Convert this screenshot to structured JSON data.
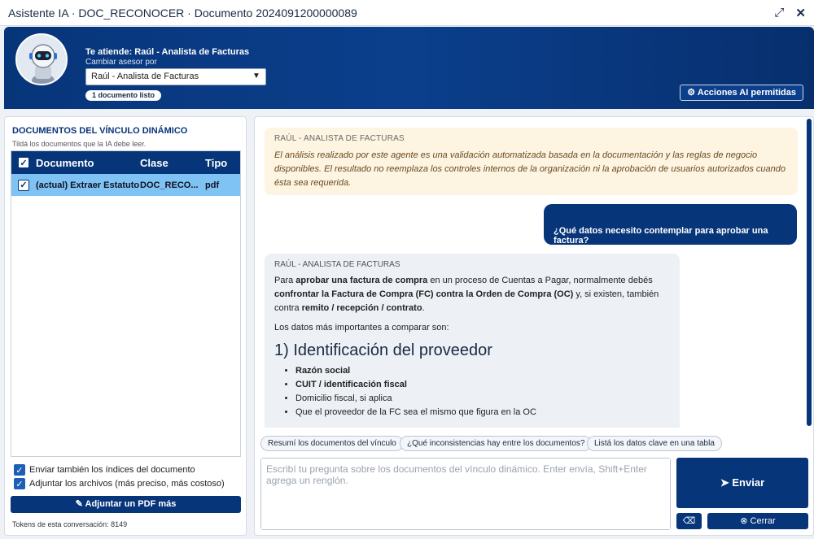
{
  "window": {
    "title": "Asistente IA · DOC_RECONOCER · Documento 2024091200000089"
  },
  "header": {
    "attending": "Te atiende: Raúl - Analista de Facturas",
    "change_label": "Cambiar asesor por",
    "advisor_selected": "Raúl - Analista de Facturas",
    "docs_badge": "1 documento listo",
    "actions_button": "Acciones AI permitidas"
  },
  "left": {
    "title": "DOCUMENTOS DEL VÍNCULO DINÁMICO",
    "subtitle": "Tildá los documentos que la IA debe leer.",
    "columns": {
      "doc": "Documento",
      "class": "Clase",
      "type": "Tipo"
    },
    "rows": [
      {
        "doc": "(actual) Extraer Estatuto",
        "class": "DOC_RECO...",
        "type": "pdf"
      }
    ],
    "option_indexes": "Enviar también los índices del documento",
    "option_files": "Adjuntar los archivos (más preciso, más costoso)",
    "attach_pdf": "Adjuntar un PDF más",
    "tokens": "Tokens de esta conversación: 8149"
  },
  "chat": {
    "notice_who": "RAÚL - ANALISTA DE FACTURAS",
    "notice_text": "El análisis realizado por este agente es una validación automatizada basada en la documentación y las reglas de negocio disponibles. El resultado no reemplaza los controles internos de la organización ni la aprobación de usuarios autorizados cuando ésta sea requerida.",
    "user_msg": "¿Qué datos necesito contemplar para aprobar una factura?",
    "ai_who": "RAÚL - ANALISTA DE FACTURAS",
    "ai_p1_a": "Para ",
    "ai_p1_b": "aprobar una factura de compra",
    "ai_p1_c": " en un proceso de Cuentas a Pagar, normalmente debés ",
    "ai_p1_d": "confrontar la Factura de Compra (FC) contra la Orden de Compra (OC)",
    "ai_p1_e": " y, si existen, también contra ",
    "ai_p1_f": "remito / recepción / contrato",
    "ai_p1_g": ".",
    "ai_p2": "Los datos más importantes a comparar son:",
    "ai_h": "1) Identificación del proveedor",
    "ai_items": [
      "Razón social",
      "CUIT / identificación fiscal",
      "Domicilio fiscal, si aplica",
      "Que el proveedor de la FC sea el mismo que figura en la OC"
    ]
  },
  "suggestions": [
    "Resumí los documentos del vínculo",
    "¿Qué inconsistencias hay entre los documentos?",
    "Listá los datos clave en una tabla"
  ],
  "composer": {
    "placeholder": "Escribí tu pregunta sobre los documentos del vínculo dinámico. Enter envía, Shift+Enter agrega un renglón.",
    "send": "Enviar",
    "close": "Cerrar"
  },
  "colors": {
    "primary": "#07357a",
    "selected_row": "#7ec3f3",
    "notice_bg": "#fdf4e1"
  }
}
